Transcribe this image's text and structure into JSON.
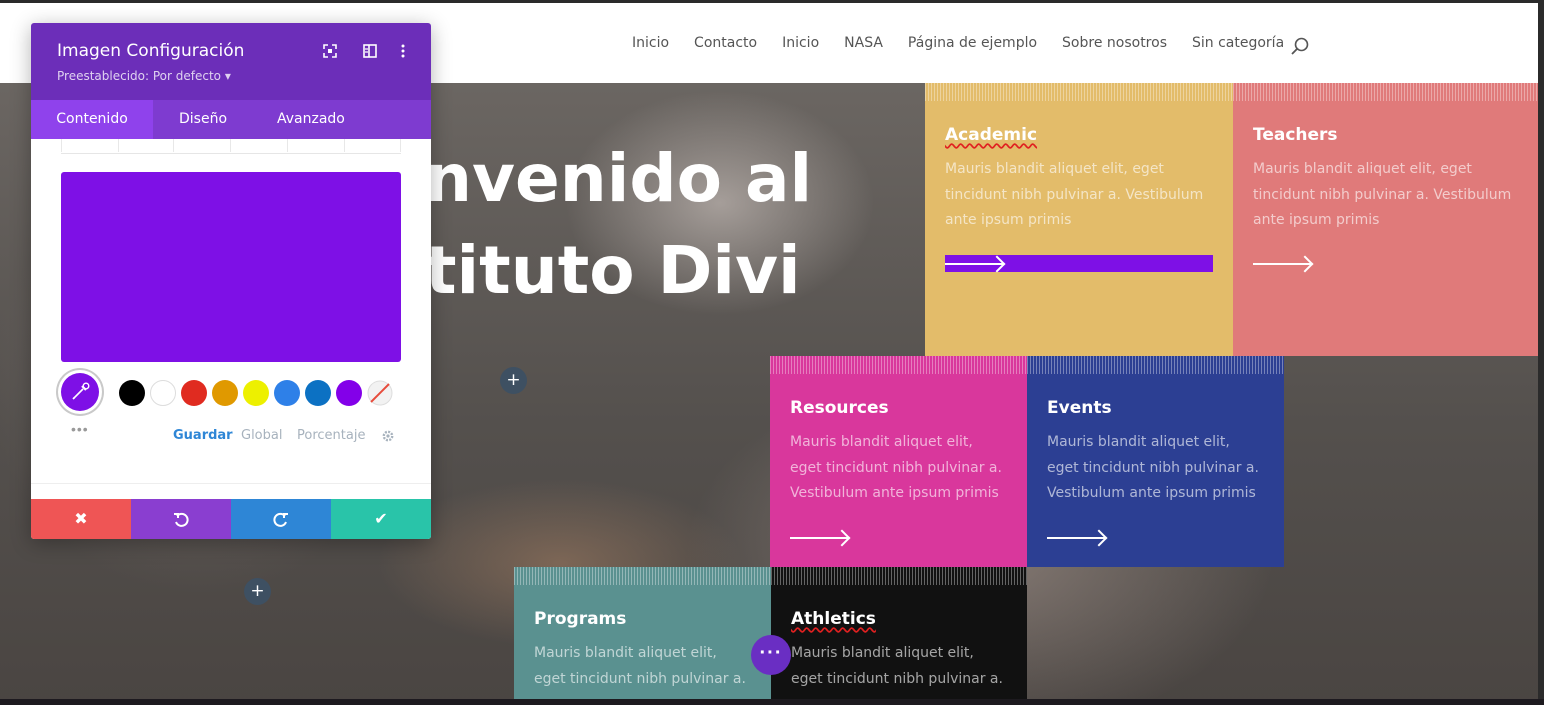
{
  "nav": {
    "items": [
      "Inicio",
      "Contacto",
      "Inicio",
      "NASA",
      "Página de ejemplo",
      "Sobre nosotros",
      "Sin categoría"
    ],
    "search_icon": "search-icon"
  },
  "hero": {
    "line1": "nvenido al",
    "line2": "tituto Divi"
  },
  "cards": [
    {
      "title": "Academic",
      "text": "Mauris blandit aliquet elit, eget tincidunt nibh pulvinar a. Vestibulum ante ipsum primis",
      "color": "#e3bc6a"
    },
    {
      "title": "Teachers",
      "text": "Mauris blandit aliquet elit, eget tincidunt nibh pulvinar a. Vestibulum ante ipsum primis",
      "color": "#e07a7a"
    },
    {
      "title": "Resources",
      "text": "Mauris blandit aliquet elit, eget tincidunt nibh pulvinar a. Vestibulum ante ipsum primis",
      "color": "#d9379c"
    },
    {
      "title": "Events",
      "text": "Mauris blandit aliquet elit, eget tincidunt nibh pulvinar a. Vestibulum ante ipsum primis",
      "color": "#2c3f93"
    },
    {
      "title": "Programs",
      "text": "Mauris blandit aliquet elit, eget tincidunt nibh pulvinar a.",
      "color": "#5a9190"
    },
    {
      "title": "Athletics",
      "text": "Mauris blandit aliquet elit, eget tincidunt nibh pulvinar a.",
      "color": "#111111"
    }
  ],
  "panel": {
    "title": "Imagen Configuración",
    "preset": "Preestablecido: Por defecto ▾",
    "tabs": [
      "Contenido",
      "Diseño",
      "Avanzado"
    ],
    "selected_color": "#7e10e6",
    "palette": [
      "#000000",
      "#ffffff",
      "#e02b20",
      "#e09900",
      "#edf000",
      "#2e80e8",
      "#0c71c3",
      "#8300e9"
    ],
    "links": {
      "save": "Guardar",
      "global": "Global",
      "percent": "Porcentaje"
    },
    "footer_colors": {
      "cancel": "#ef5555",
      "undo": "#8a3ed0",
      "redo": "#2e86d6",
      "confirm": "#29c4a9"
    }
  },
  "colors": {
    "accent": "#6c2eb9",
    "tab_active": "#8f42ec"
  }
}
